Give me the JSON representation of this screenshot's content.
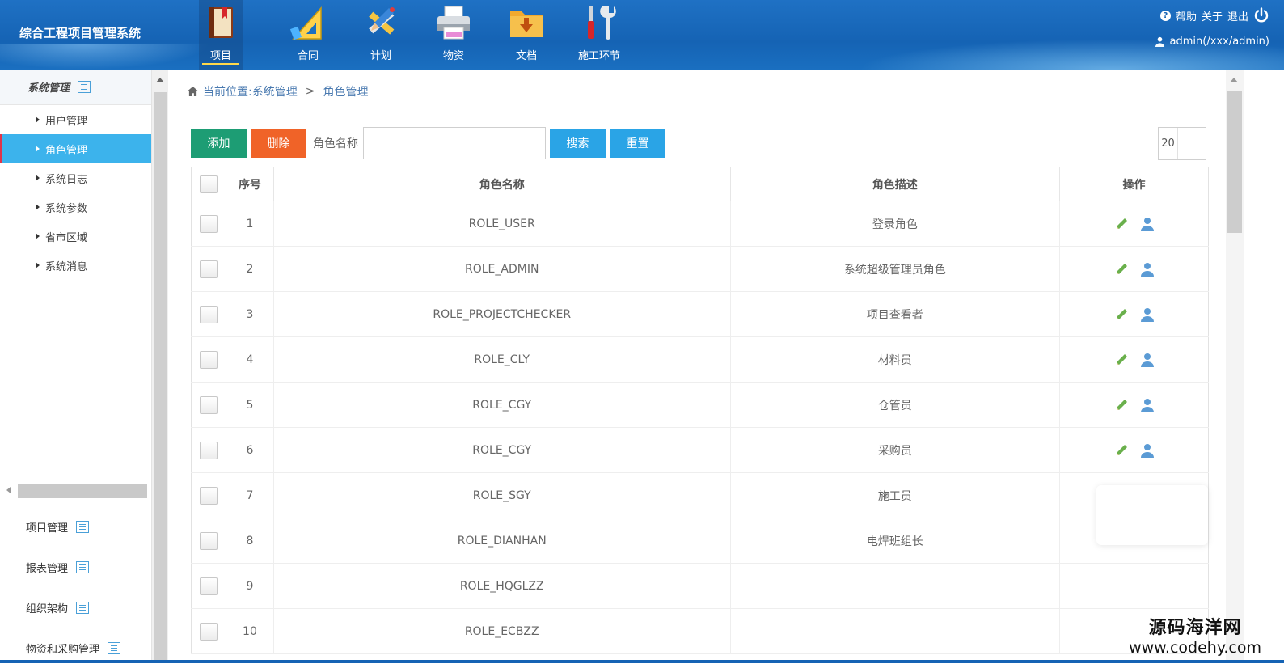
{
  "app": {
    "title": "综合工程项目管理系统"
  },
  "nav": [
    {
      "label": "项目",
      "icon": "book-icon",
      "active": true
    },
    {
      "label": "合同",
      "icon": "triangle-ruler-icon",
      "active": false
    },
    {
      "label": "计划",
      "icon": "pencil-ruler-icon",
      "active": false
    },
    {
      "label": "物资",
      "icon": "printer-icon",
      "active": false
    },
    {
      "label": "文档",
      "icon": "folder-download-icon",
      "active": false
    },
    {
      "label": "施工环节",
      "icon": "tools-icon",
      "active": false
    }
  ],
  "header_right": {
    "help": "帮助",
    "about": "关于",
    "logout": "退出",
    "user": "admin(/xxx/admin)"
  },
  "sidebar": {
    "section": "系统管理",
    "items": [
      {
        "label": "用户管理",
        "active": false
      },
      {
        "label": "角色管理",
        "active": true
      },
      {
        "label": "系统日志",
        "active": false
      },
      {
        "label": "系统参数",
        "active": false
      },
      {
        "label": "省市区域",
        "active": false
      },
      {
        "label": "系统消息",
        "active": false
      }
    ],
    "groups": [
      "项目管理",
      "报表管理",
      "组织架构",
      "物资和采购管理"
    ]
  },
  "breadcrumb": {
    "prefix": "当前位置:",
    "parent": "系统管理",
    "separator": ">",
    "current": "角色管理"
  },
  "toolbar": {
    "add": "添加",
    "delete": "删除",
    "role_name_label": "角色名称",
    "role_name_value": "",
    "search": "搜索",
    "reset": "重置",
    "page_size": "20"
  },
  "table": {
    "headers": [
      "序号",
      "角色名称",
      "角色描述",
      "操作"
    ],
    "rows": [
      {
        "no": "1",
        "name": "ROLE_USER",
        "desc": "登录角色"
      },
      {
        "no": "2",
        "name": "ROLE_ADMIN",
        "desc": "系统超级管理员角色"
      },
      {
        "no": "3",
        "name": "ROLE_PROJECTCHECKER",
        "desc": "项目查看者"
      },
      {
        "no": "4",
        "name": "ROLE_CLY",
        "desc": "材料员"
      },
      {
        "no": "5",
        "name": "ROLE_CGY",
        "desc": "仓管员"
      },
      {
        "no": "6",
        "name": "ROLE_CGY",
        "desc": "采购员"
      },
      {
        "no": "7",
        "name": "ROLE_SGY",
        "desc": "施工员"
      },
      {
        "no": "8",
        "name": "ROLE_DIANHAN",
        "desc": "电焊班组长"
      },
      {
        "no": "9",
        "name": "ROLE_HQGLZZ",
        "desc": ""
      },
      {
        "no": "10",
        "name": "ROLE_ECBZZ",
        "desc": ""
      }
    ]
  },
  "watermark": {
    "line1": "源码海洋网",
    "line2": "www.codehy.com"
  },
  "colors": {
    "header": "#1563b4",
    "accent": "#3cb3ec",
    "add": "#1d9d74",
    "delete": "#f06328",
    "search": "#2aa4e6"
  }
}
